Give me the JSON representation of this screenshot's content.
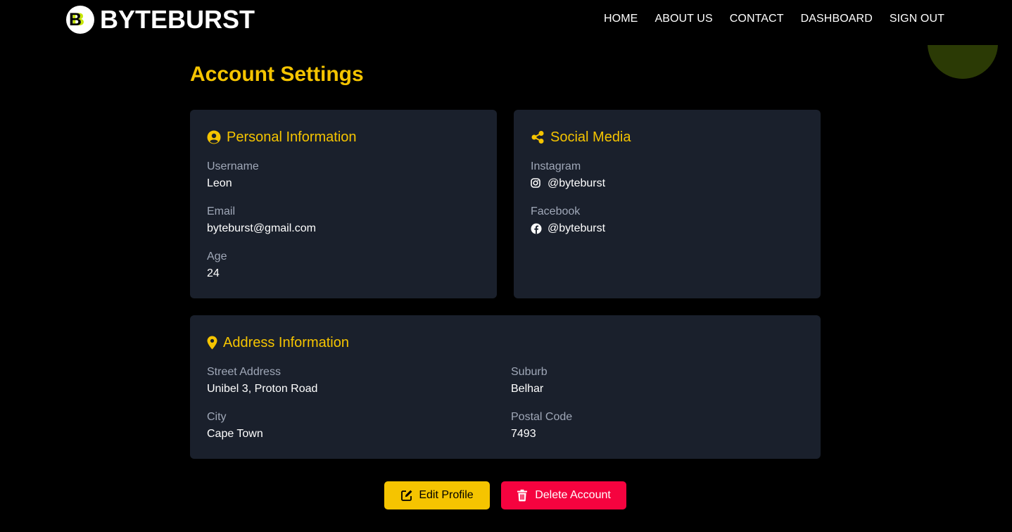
{
  "brand": {
    "name": "BYTEBURST",
    "logo_letter": "B"
  },
  "nav": {
    "items": [
      {
        "label": "HOME"
      },
      {
        "label": "ABOUT US"
      },
      {
        "label": "CONTACT"
      },
      {
        "label": "DASHBOARD"
      },
      {
        "label": "SIGN OUT"
      }
    ]
  },
  "page": {
    "title": "Account Settings"
  },
  "personal": {
    "title": "Personal Information",
    "icon": "user-circle-icon",
    "fields": [
      {
        "label": "Username",
        "value": "Leon"
      },
      {
        "label": "Email",
        "value": "byteburst@gmail.com"
      },
      {
        "label": "Age",
        "value": "24"
      }
    ]
  },
  "social": {
    "title": "Social Media",
    "icon": "share-icon",
    "fields": [
      {
        "label": "Instagram",
        "value": "@byteburst",
        "icon": "instagram-icon"
      },
      {
        "label": "Facebook",
        "value": "@byteburst",
        "icon": "facebook-icon"
      }
    ]
  },
  "address": {
    "title": "Address Information",
    "icon": "map-pin-icon",
    "fields": [
      {
        "label": "Street Address",
        "value": "Unibel 3, Proton Road"
      },
      {
        "label": "Suburb",
        "value": "Belhar"
      },
      {
        "label": "City",
        "value": "Cape Town"
      },
      {
        "label": "Postal Code",
        "value": "7493"
      }
    ]
  },
  "actions": {
    "edit_label": "Edit Profile",
    "delete_label": "Delete Account"
  },
  "colors": {
    "accent": "#f5c400",
    "card_bg": "#1a202c",
    "danger": "#f5033f",
    "logo_green": "#c6e600"
  }
}
